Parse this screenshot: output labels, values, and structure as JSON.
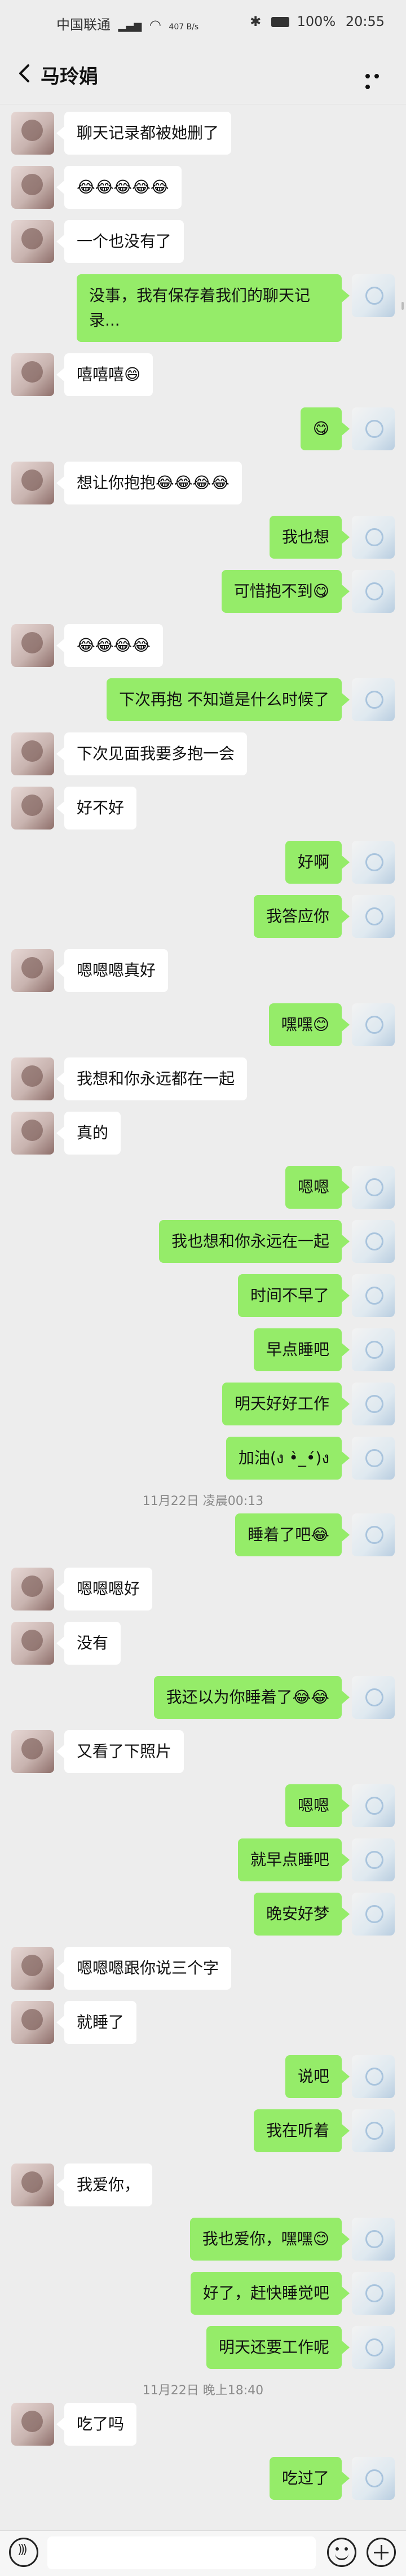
{
  "status_bar": {
    "carrier": "中国联通",
    "net_speed": "407 B/s",
    "battery": "100%",
    "time": "20:55"
  },
  "header": {
    "title": "马玲娟",
    "back_icon": "chevron-left-icon",
    "more_icon": "more-dots-icon"
  },
  "colors": {
    "background": "#ededed",
    "my_bubble": "#95ec69",
    "other_bubble": "#ffffff",
    "timestamp": "#8a8a8a"
  },
  "messages": [
    {
      "type": "msg",
      "side": "other",
      "text": "聊天记录都被她删了"
    },
    {
      "type": "msg",
      "side": "other",
      "text": "😂😂😂😂😂"
    },
    {
      "type": "msg",
      "side": "other",
      "text": "一个也没有了"
    },
    {
      "type": "msg",
      "side": "me",
      "text": "没事，我有保存着我们的聊天记录..."
    },
    {
      "type": "msg",
      "side": "other",
      "text": "嘻嘻嘻😄"
    },
    {
      "type": "msg",
      "side": "me",
      "text": "😋"
    },
    {
      "type": "msg",
      "side": "other",
      "text": "想让你抱抱😂😂😂😂"
    },
    {
      "type": "msg",
      "side": "me",
      "text": "我也想"
    },
    {
      "type": "msg",
      "side": "me",
      "text": "可惜抱不到😋"
    },
    {
      "type": "msg",
      "side": "other",
      "text": "😂😂😂😂"
    },
    {
      "type": "msg",
      "side": "me",
      "text": "下次再抱 不知道是什么时候了"
    },
    {
      "type": "msg",
      "side": "other",
      "text": "下次见面我要多抱一会"
    },
    {
      "type": "msg",
      "side": "other",
      "text": "好不好"
    },
    {
      "type": "msg",
      "side": "me",
      "text": "好啊"
    },
    {
      "type": "msg",
      "side": "me",
      "text": "我答应你"
    },
    {
      "type": "msg",
      "side": "other",
      "text": "嗯嗯嗯真好"
    },
    {
      "type": "msg",
      "side": "me",
      "text": "嘿嘿😊"
    },
    {
      "type": "msg",
      "side": "other",
      "text": "我想和你永远都在一起"
    },
    {
      "type": "msg",
      "side": "other",
      "text": "真的"
    },
    {
      "type": "msg",
      "side": "me",
      "text": "嗯嗯"
    },
    {
      "type": "msg",
      "side": "me",
      "text": "我也想和你永远在一起"
    },
    {
      "type": "msg",
      "side": "me",
      "text": "时间不早了"
    },
    {
      "type": "msg",
      "side": "me",
      "text": "早点睡吧"
    },
    {
      "type": "msg",
      "side": "me",
      "text": "明天好好工作"
    },
    {
      "type": "msg",
      "side": "me",
      "text": "加油(ง •̀_•́)ง"
    },
    {
      "type": "time",
      "text": "11月22日 凌晨00:13"
    },
    {
      "type": "msg",
      "side": "me",
      "text": "睡着了吧😂"
    },
    {
      "type": "msg",
      "side": "other",
      "text": "嗯嗯嗯好"
    },
    {
      "type": "msg",
      "side": "other",
      "text": "没有"
    },
    {
      "type": "msg",
      "side": "me",
      "text": "我还以为你睡着了😂😂"
    },
    {
      "type": "msg",
      "side": "other",
      "text": "又看了下照片"
    },
    {
      "type": "msg",
      "side": "me",
      "text": "嗯嗯"
    },
    {
      "type": "msg",
      "side": "me",
      "text": "就早点睡吧"
    },
    {
      "type": "msg",
      "side": "me",
      "text": "晚安好梦"
    },
    {
      "type": "msg",
      "side": "other",
      "text": "嗯嗯嗯跟你说三个字"
    },
    {
      "type": "msg",
      "side": "other",
      "text": "就睡了"
    },
    {
      "type": "msg",
      "side": "me",
      "text": "说吧"
    },
    {
      "type": "msg",
      "side": "me",
      "text": "我在听着"
    },
    {
      "type": "msg",
      "side": "other",
      "text": "我爱你，"
    },
    {
      "type": "msg",
      "side": "me",
      "text": "我也爱你，嘿嘿😊"
    },
    {
      "type": "msg",
      "side": "me",
      "text": "好了，赶快睡觉吧"
    },
    {
      "type": "msg",
      "side": "me",
      "text": "明天还要工作呢"
    },
    {
      "type": "time",
      "text": "11月22日 晚上18:40"
    },
    {
      "type": "msg",
      "side": "other",
      "text": "吃了吗"
    },
    {
      "type": "msg",
      "side": "me",
      "text": "吃过了"
    }
  ],
  "input_bar": {
    "voice_icon": "voice-icon",
    "emoji_icon": "emoji-icon",
    "plus_icon": "plus-icon"
  }
}
